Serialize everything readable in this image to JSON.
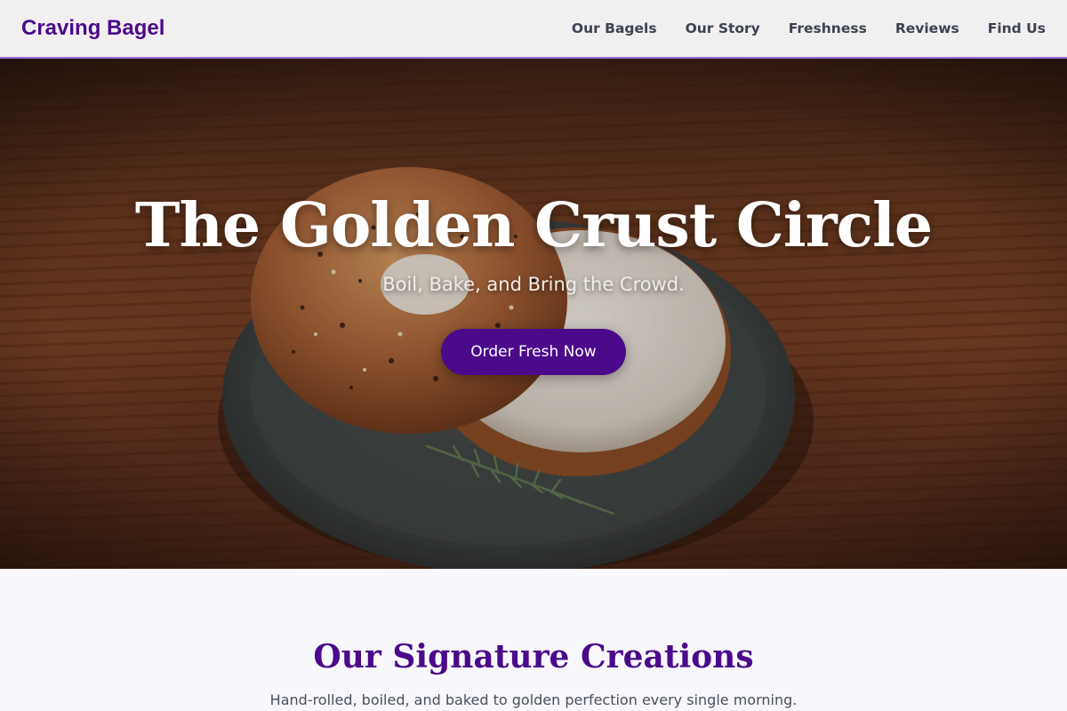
{
  "brand": {
    "name": "Craving Bagel",
    "color": "#4b0a8a"
  },
  "nav": {
    "items": [
      {
        "label": "Our Bagels"
      },
      {
        "label": "Our Story"
      },
      {
        "label": "Freshness"
      },
      {
        "label": "Reviews"
      },
      {
        "label": "Find Us"
      }
    ]
  },
  "hero": {
    "title": "The Golden Crust Circle",
    "subtitle": "Boil, Bake, and Bring the Crowd.",
    "cta_label": "Order Fresh Now",
    "image": "bagel-on-plate-photo"
  },
  "section": {
    "title": "Our Signature Creations",
    "subtitle": "Hand-rolled, boiled, and baked to golden perfection every single morning."
  },
  "colors": {
    "accent": "#4b0a8a",
    "header_border": "#9b6fd6",
    "header_bg": "#f1efef",
    "page_bg": "#f8f8fc"
  }
}
